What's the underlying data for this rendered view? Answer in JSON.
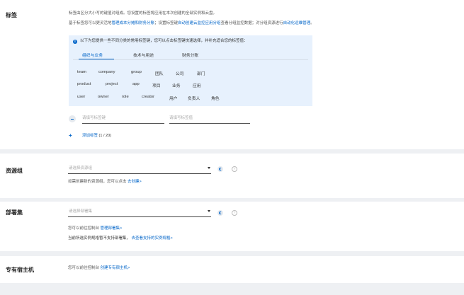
{
  "tags": {
    "title": "标签",
    "desc1": "标签由区分大小写的键值对组成。您设置的标签将应用在本次创建的全部实例和云盘。",
    "desc2_prefix": "基于标签您可以更灵活地",
    "desc2_link1": "管理成本分摊和财务分账",
    "desc2_mid": "；设置标签键",
    "desc2_link2": "自动创建云监控应用分组",
    "desc2_mid2": "查看分组监控数据；对分组资源进行",
    "desc2_link3": "自动化运维管理",
    "desc2_end": "。",
    "tip": "以下为您提供一些不同分类的常用标签键，您可以点击标签键快速选择，并补充适合您的标签值：",
    "tabs": [
      "组织与业务",
      "技术与用途",
      "财务分账"
    ],
    "tag_rows": [
      [
        "team",
        "company",
        "group",
        "团队",
        "公司",
        "部门"
      ],
      [
        "product",
        "project",
        "app",
        "项目",
        "业务",
        "应用"
      ],
      [
        "user",
        "owner",
        "role",
        "creator",
        "用户",
        "负责人",
        "角色"
      ]
    ],
    "key_placeholder": "请填写标签键",
    "value_placeholder": "请填写标签值",
    "add_label": "添加标签",
    "add_count": "(1 / 20)"
  },
  "resource_group": {
    "title": "资源组",
    "placeholder": "请选择资源组",
    "help_prefix": "如需创建新的资源组，您可以点击",
    "help_link": "去创建>"
  },
  "deployment_set": {
    "title": "部署集",
    "placeholder": "请选择部署集",
    "line1_prefix": "您可以前往控制台",
    "line1_link": "管理部署集>",
    "line2_prefix": "当前所选实例规格暂不支持部署集，",
    "line2_link": "去查看支持的实例规格>"
  },
  "dedicated_host": {
    "title": "专有宿主机",
    "line_prefix": "您可以前往控制台",
    "line_link": "创建专有宿主机>"
  },
  "colors": {
    "accent": "#0064c8",
    "info_bg": "#e7f1fd",
    "page_bg": "#eef0f3"
  },
  "icons": [
    "info-icon",
    "minus-icon",
    "plus-icon",
    "caret-down-icon",
    "refresh-icon",
    "help-icon"
  ]
}
